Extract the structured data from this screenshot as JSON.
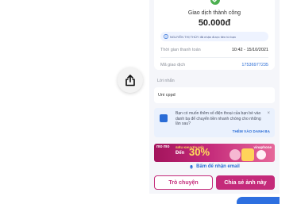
{
  "share_icon": "share-icon",
  "transaction": {
    "status": "Giao dịch thành công",
    "amount": "50.000đ",
    "note": "NGUYỄN THỊ THÚY đã nhận được tiền từ bạn",
    "time_label": "Thời gian thanh toán",
    "time_value": "10:42 - 15/10/2021",
    "code_label": "Mã giao dịch",
    "code_value": "17536977235"
  },
  "message": {
    "label": "Lời nhắn",
    "text": "Uni cppd"
  },
  "prompt": {
    "text": "Bạn có muốn thêm số điện thoại của bạn bè vào danh bạ để chuyển tiền nhanh chóng cho những lần sau?",
    "link": "THÊM VÀO DANH BẠ"
  },
  "banner": {
    "logo": "mo mo",
    "tag": "SIÊU KHUYẾN MÃI",
    "prefix": "Đến",
    "percent": "30%",
    "partner": "vinaphone"
  },
  "email_cta": "Bấm để nhận email",
  "buttons": {
    "chat": "Trò chuyện",
    "share": "Chia sẻ ảnh này"
  },
  "colors": {
    "brand": "#c42a7a",
    "link": "#2a6cd6",
    "success": "#4caf50"
  }
}
